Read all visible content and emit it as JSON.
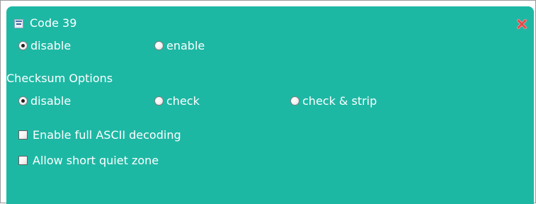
{
  "panel": {
    "title": "Code 39",
    "collapse_icon": "collapse-minus-icon",
    "close_icon": "close-x-icon",
    "bg_color": "#1db8a4"
  },
  "code39": {
    "options": [
      {
        "label": "disable",
        "checked": true
      },
      {
        "label": "enable",
        "checked": false
      }
    ]
  },
  "checksum": {
    "heading": "Checksum Options",
    "options": [
      {
        "label": "disable",
        "checked": true
      },
      {
        "label": "check",
        "checked": false
      },
      {
        "label": "check & strip",
        "checked": false
      }
    ]
  },
  "checkboxes": [
    {
      "label": "Enable full ASCII decoding",
      "checked": false
    },
    {
      "label": "Allow short quiet zone",
      "checked": false
    }
  ]
}
